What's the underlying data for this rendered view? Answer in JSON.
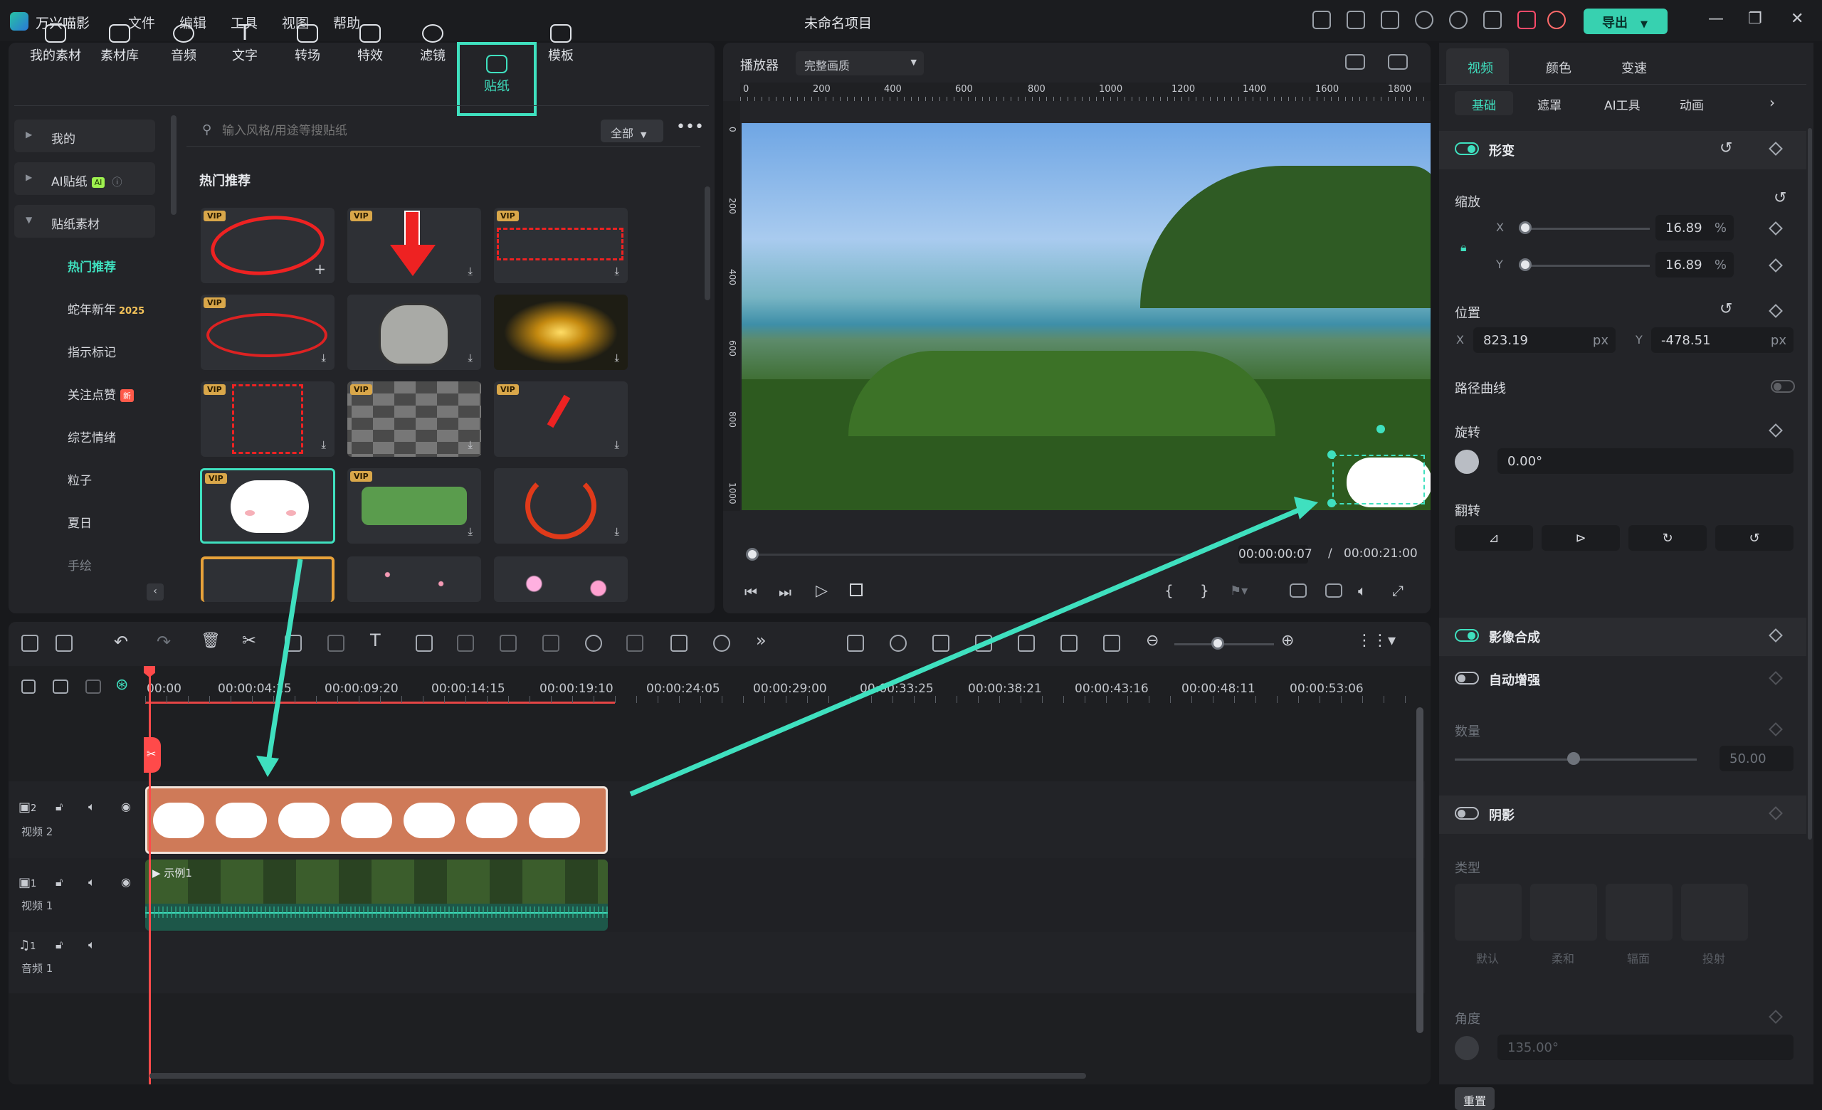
{
  "app": {
    "name": "万兴喵影",
    "project": "未命名项目",
    "export": "导出"
  },
  "menu": [
    "文件",
    "编辑",
    "工具",
    "视图",
    "帮助"
  ],
  "tools": [
    "我的素材",
    "素材库",
    "音频",
    "文字",
    "转场",
    "特效",
    "滤镜",
    "贴纸",
    "模板"
  ],
  "sidebar": {
    "items": [
      "我的",
      "AI贴纸",
      "贴纸素材",
      "热门推荐",
      "蛇年新年",
      "指示标记",
      "关注点赞",
      "综艺情绪",
      "粒子",
      "夏日",
      "手绘"
    ],
    "ai_badge": "AI",
    "new_badge": "新",
    "year_suffix": "2025"
  },
  "search": {
    "placeholder": "输入风格/用途等搜贴纸",
    "filter": "全部"
  },
  "stickers": {
    "category": "热门推荐",
    "vip": "VIP"
  },
  "player": {
    "label": "播放器",
    "quality": "完整画质",
    "current": "00:00:00:07",
    "separator": "/",
    "total": "00:00:21:00",
    "ruler": [
      "0",
      "200",
      "400",
      "600",
      "800",
      "1000",
      "1200",
      "1400",
      "1600",
      "1800"
    ],
    "vruler": [
      "0",
      "200",
      "400",
      "600",
      "800",
      "1000"
    ]
  },
  "props": {
    "tabs": [
      "视频",
      "颜色",
      "变速"
    ],
    "subtabs": [
      "基础",
      "遮罩",
      "AI工具",
      "动画"
    ],
    "transform": "形变",
    "scale": "缩放",
    "x": "X",
    "y": "Y",
    "scale_x": "16.89",
    "scale_y": "16.89",
    "percent": "%",
    "position": "位置",
    "pos_x": "823.19",
    "pos_y": "-478.51",
    "px": "px",
    "path": "路径曲线",
    "rotate": "旋转",
    "rotate_val": "0.00°",
    "flip": "翻转",
    "compositing": "影像合成",
    "auto_enhance": "自动增强",
    "amount": "数量",
    "amount_val": "50.00",
    "shadow": "阴影",
    "type": "类型",
    "shadow_types": [
      "默认",
      "柔和",
      "辐面",
      "投射"
    ],
    "angle": "角度",
    "angle_val": "135.00°",
    "reset": "重置"
  },
  "timeline": {
    "timecodes": [
      "00:00",
      "00:00:04:25",
      "00:00:09:20",
      "00:00:14:15",
      "00:00:19:10",
      "00:00:24:05",
      "00:00:29:00",
      "00:00:33:25",
      "00:00:38:21",
      "00:00:43:16",
      "00:00:48:11",
      "00:00:53:06"
    ],
    "tracks": [
      {
        "num": "2",
        "label": "视频 2"
      },
      {
        "num": "1",
        "label": "视频 1"
      },
      {
        "num": "1",
        "label": "音频 1"
      }
    ],
    "video_clip": "示例1"
  },
  "colors": {
    "accent": "#3fe0bf",
    "sticker_clip": "#cf7a58",
    "playhead": "#ff4a4a"
  }
}
